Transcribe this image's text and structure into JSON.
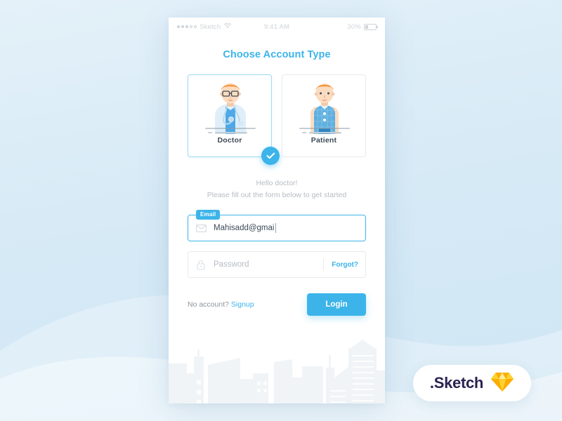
{
  "colors": {
    "accent": "#3cb4ea",
    "page_bg_top": "#e4f1f9",
    "page_bg_bottom": "#cfe6f4",
    "card_border": "#e7eaed",
    "card_border_selected": "#9fd9f2",
    "text_dark": "#3d4a57",
    "text_muted": "#b6bcc3",
    "sketch_logo": "#fdad00"
  },
  "status_bar": {
    "carrier": "Sketch",
    "signal_filled": 3,
    "signal_empty": 2,
    "wifi_icon": "wifi-icon",
    "time": "9:41 AM",
    "battery_percent": "30%",
    "battery_level": 30
  },
  "header": {
    "title": "Choose Account Type"
  },
  "account_types": [
    {
      "label": "Doctor",
      "illustration": "doctor-illustration",
      "selected": true,
      "badge_icon": "check-icon"
    },
    {
      "label": "Patient",
      "illustration": "patient-illustration",
      "selected": false
    }
  ],
  "greeting": {
    "line1": "Hello doctor!",
    "line2": "Please fill out the form below to get started"
  },
  "form": {
    "email": {
      "badge_label": "Email",
      "icon": "envelope-icon",
      "value": "Mahisadd@gmai",
      "placeholder": "Email",
      "focused": true
    },
    "password": {
      "icon": "lock-icon",
      "value": "",
      "placeholder": "Password",
      "forgot_label": "Forgot?"
    }
  },
  "footer": {
    "no_account_text": "No account?",
    "signup_label": "Signup",
    "login_label": "Login"
  },
  "watermark": {
    "label": ".Sketch",
    "logo_icon": "sketch-diamond-icon"
  }
}
